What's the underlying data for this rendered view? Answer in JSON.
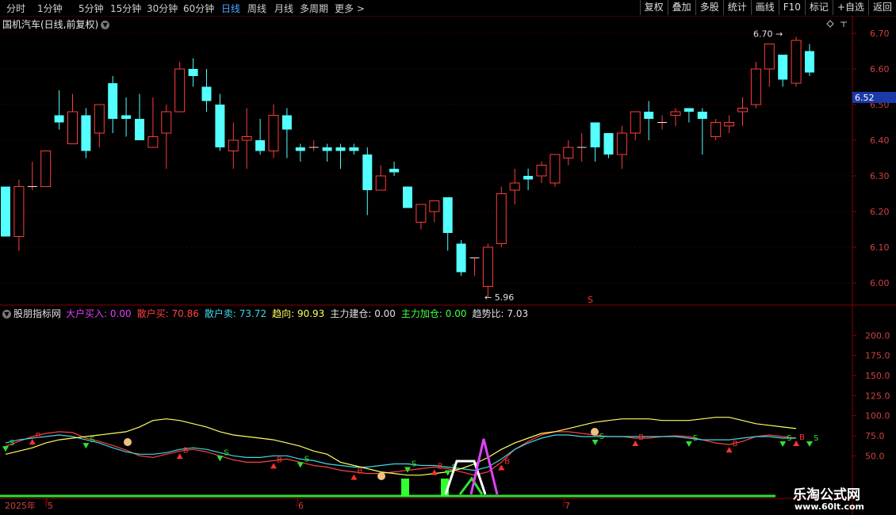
{
  "toolbar": {
    "periods": [
      "分时",
      "1分钟",
      "5分钟",
      "15分钟",
      "30分钟",
      "60分钟",
      "日线",
      "周线",
      "月线",
      "多周期",
      "更多 >"
    ],
    "active_period": "日线",
    "right_buttons": [
      "复权",
      "叠加",
      "多股",
      "统计",
      "画线",
      "F10",
      "标记",
      "+自选",
      "返回"
    ]
  },
  "stock": {
    "title": "国机汽车(日线,前复权)",
    "current_price": "6.52",
    "high_label": "6.70",
    "low_label": "5.96",
    "signal_mark": "S"
  },
  "indicator": {
    "name": "股朋指标网",
    "fields": [
      {
        "label": "大户买入:",
        "value": "0.00",
        "color": "#e040fb"
      },
      {
        "label": "散户买:",
        "value": "70.86",
        "color": "#ff4040"
      },
      {
        "label": "散户卖:",
        "value": "73.72",
        "color": "#40d8e8"
      },
      {
        "label": "趋向:",
        "value": "90.93",
        "color": "#ffff60"
      },
      {
        "label": "主力建仓:",
        "value": "0.00",
        "color": "#e0e0e0"
      },
      {
        "label": "主力加仓:",
        "value": "0.00",
        "color": "#40ff40"
      },
      {
        "label": "趋势比:",
        "value": "7.03",
        "color": "#e0e0e0"
      }
    ]
  },
  "axis": {
    "price_ticks": [
      "6.70",
      "6.60",
      "6.50",
      "6.40",
      "6.30",
      "6.20",
      "6.10",
      "6.00"
    ],
    "indicator_ticks": [
      "200.0",
      "175.0",
      "150.0",
      "125.0",
      "100.0",
      "75.0",
      "50.0"
    ],
    "date_labels": [
      "2025年",
      "5",
      "6",
      "7"
    ]
  },
  "colors": {
    "up": "#ff3c3c",
    "down": "#54ffff",
    "background": "#000000",
    "grid": "#3a0000",
    "active": "#4aa8ff"
  },
  "watermark": {
    "line1": "乐淘公式网",
    "line2": "www.60lt.com"
  },
  "chart_data": [
    {
      "type": "candlestick",
      "title": "国机汽车(日线,前复权)",
      "ylim": [
        5.94,
        6.74
      ],
      "candles": [
        [
          6.27,
          6.27,
          6.13,
          6.13
        ],
        [
          6.13,
          6.29,
          6.09,
          6.27
        ],
        [
          6.27,
          6.34,
          6.26,
          6.27
        ],
        [
          6.27,
          6.37,
          6.27,
          6.37
        ],
        [
          6.47,
          6.54,
          6.43,
          6.45
        ],
        [
          6.39,
          6.53,
          6.39,
          6.48
        ],
        [
          6.47,
          6.49,
          6.35,
          6.37
        ],
        [
          6.42,
          6.48,
          6.38,
          6.5
        ],
        [
          6.56,
          6.58,
          6.42,
          6.46
        ],
        [
          6.47,
          6.52,
          6.41,
          6.46
        ],
        [
          6.46,
          6.53,
          6.41,
          6.4
        ],
        [
          6.38,
          6.52,
          6.38,
          6.41
        ],
        [
          6.42,
          6.5,
          6.32,
          6.48
        ],
        [
          6.48,
          6.62,
          6.48,
          6.6
        ],
        [
          6.6,
          6.63,
          6.55,
          6.58
        ],
        [
          6.55,
          6.6,
          6.48,
          6.51
        ],
        [
          6.5,
          6.53,
          6.37,
          6.38
        ],
        [
          6.37,
          6.45,
          6.32,
          6.4
        ],
        [
          6.4,
          6.49,
          6.32,
          6.41
        ],
        [
          6.4,
          6.46,
          6.36,
          6.37
        ],
        [
          6.37,
          6.5,
          6.35,
          6.47
        ],
        [
          6.47,
          6.49,
          6.35,
          6.43
        ],
        [
          6.38,
          6.39,
          6.34,
          6.37
        ],
        [
          6.38,
          6.4,
          6.37,
          6.38
        ],
        [
          6.38,
          6.39,
          6.34,
          6.37
        ],
        [
          6.38,
          6.39,
          6.32,
          6.37
        ],
        [
          6.38,
          6.39,
          6.36,
          6.37
        ],
        [
          6.36,
          6.38,
          6.19,
          6.26
        ],
        [
          6.26,
          6.33,
          6.26,
          6.3
        ],
        [
          6.32,
          6.34,
          6.3,
          6.31
        ],
        [
          6.27,
          6.27,
          6.21,
          6.21
        ],
        [
          6.17,
          6.22,
          6.15,
          6.22
        ],
        [
          6.2,
          6.23,
          6.17,
          6.23
        ],
        [
          6.24,
          6.24,
          6.09,
          6.14
        ],
        [
          6.11,
          6.12,
          6.02,
          6.03
        ],
        [
          6.07,
          6.07,
          6.02,
          6.07
        ],
        [
          5.99,
          6.11,
          5.96,
          6.1
        ],
        [
          6.11,
          6.27,
          6.1,
          6.25
        ],
        [
          6.26,
          6.32,
          6.22,
          6.28
        ],
        [
          6.3,
          6.32,
          6.26,
          6.29
        ],
        [
          6.3,
          6.34,
          6.28,
          6.33
        ],
        [
          6.28,
          6.36,
          6.27,
          6.36
        ],
        [
          6.35,
          6.4,
          6.33,
          6.38
        ],
        [
          6.38,
          6.42,
          6.34,
          6.38
        ],
        [
          6.45,
          6.45,
          6.34,
          6.38
        ],
        [
          6.42,
          6.42,
          6.35,
          6.36
        ],
        [
          6.36,
          6.44,
          6.32,
          6.42
        ],
        [
          6.42,
          6.48,
          6.4,
          6.48
        ],
        [
          6.48,
          6.51,
          6.4,
          6.46
        ],
        [
          6.45,
          6.47,
          6.43,
          6.45
        ],
        [
          6.47,
          6.49,
          6.44,
          6.48
        ],
        [
          6.49,
          6.49,
          6.45,
          6.48
        ],
        [
          6.48,
          6.49,
          6.36,
          6.46
        ],
        [
          6.41,
          6.46,
          6.4,
          6.45
        ],
        [
          6.44,
          6.47,
          6.42,
          6.45
        ],
        [
          6.48,
          6.52,
          6.44,
          6.49
        ],
        [
          6.5,
          6.62,
          6.49,
          6.6
        ],
        [
          6.6,
          6.64,
          6.55,
          6.67
        ],
        [
          6.64,
          6.64,
          6.55,
          6.57
        ],
        [
          6.56,
          6.69,
          6.55,
          6.68
        ],
        [
          6.65,
          6.67,
          6.58,
          6.59
        ]
      ]
    },
    {
      "type": "line",
      "title": "股朋指标网",
      "ylim": [
        0,
        225
      ],
      "series": [
        {
          "name": "散户买",
          "color": "#ff4040",
          "values": [
            62,
            68,
            74,
            78,
            80,
            79,
            72,
            68,
            63,
            57,
            50,
            48,
            52,
            56,
            58,
            55,
            50,
            45,
            42,
            42,
            44,
            46,
            42,
            38,
            36,
            32,
            30,
            28,
            28,
            30,
            32,
            34,
            36,
            34,
            30,
            26,
            30,
            42,
            58,
            68,
            76,
            80,
            80,
            78,
            76,
            74,
            74,
            72,
            72,
            74,
            75,
            74,
            70,
            66,
            64,
            68,
            74,
            76,
            74,
            72
          ]
        },
        {
          "name": "散户卖",
          "color": "#40d8e8",
          "values": [
            66,
            70,
            72,
            74,
            76,
            74,
            70,
            66,
            60,
            55,
            52,
            52,
            54,
            58,
            60,
            58,
            54,
            50,
            48,
            48,
            50,
            50,
            46,
            44,
            40,
            38,
            36,
            36,
            38,
            40,
            40,
            38,
            38,
            36,
            34,
            32,
            36,
            46,
            58,
            66,
            72,
            76,
            76,
            74,
            74,
            74,
            74,
            74,
            74,
            74,
            74,
            72,
            70,
            70,
            70,
            72,
            74,
            74,
            72,
            72
          ]
        },
        {
          "name": "趋向",
          "color": "#ffff60",
          "values": [
            52,
            56,
            60,
            66,
            70,
            72,
            74,
            76,
            78,
            80,
            86,
            94,
            96,
            94,
            90,
            86,
            80,
            76,
            74,
            72,
            70,
            66,
            62,
            56,
            52,
            42,
            38,
            34,
            30,
            28,
            26,
            26,
            28,
            30,
            34,
            40,
            48,
            58,
            66,
            72,
            78,
            80,
            84,
            88,
            92,
            94,
            96,
            96,
            96,
            94,
            94,
            94,
            96,
            98,
            98,
            94,
            90,
            88,
            86,
            84
          ]
        }
      ]
    }
  ]
}
